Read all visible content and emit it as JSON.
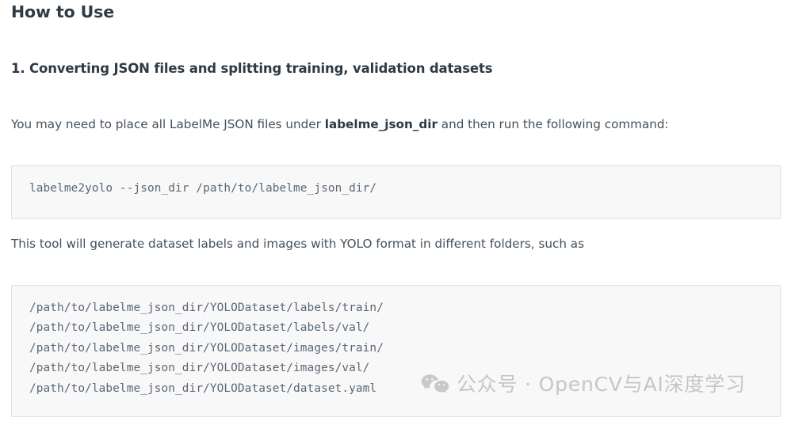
{
  "document": {
    "heading": "How to Use",
    "section_heading": "1. Converting JSON files and splitting training, validation datasets",
    "paragraph_1": {
      "before": "You may need to place all LabelMe JSON files under ",
      "bold": "labelme_json_dir",
      "after": " and then run the following command:"
    },
    "paragraph_2": "This tool will generate dataset labels and images with YOLO format in different folders, such as",
    "code_block_1": {
      "lines": [
        "labelme2yolo --json_dir /path/to/labelme_json_dir/"
      ]
    },
    "code_block_2": {
      "lines": [
        "/path/to/labelme_json_dir/YOLODataset/labels/train/",
        "/path/to/labelme_json_dir/YOLODataset/labels/val/",
        "/path/to/labelme_json_dir/YOLODataset/images/train/",
        "/path/to/labelme_json_dir/YOLODataset/images/val/",
        "/path/to/labelme_json_dir/YOLODataset/dataset.yaml"
      ]
    }
  },
  "watermark": {
    "icon": "wechat-icon",
    "text": "公众号 · OpenCV与AI深度学习",
    "color": "#c6c6c6"
  },
  "colors": {
    "page_background": "#ffffff",
    "heading_text": "#2f3a44",
    "body_text": "#44505b",
    "code_text": "#5a6775",
    "code_background": "#f8f8f8",
    "code_border": "#e1e1e1"
  }
}
